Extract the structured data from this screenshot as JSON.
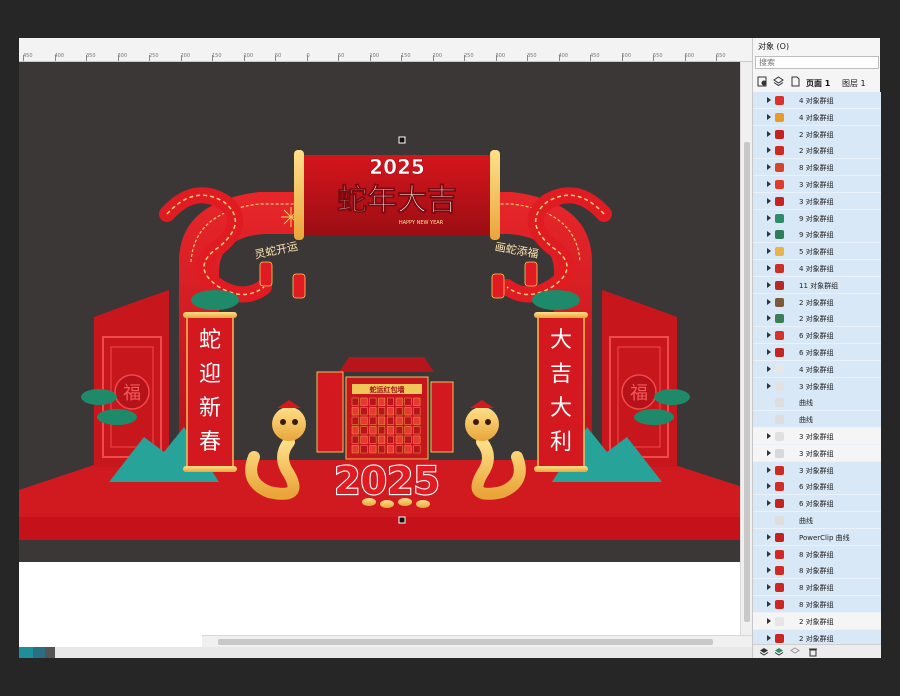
{
  "ruler": {
    "labels": [
      "450",
      "400",
      "350",
      "300",
      "250",
      "200",
      "150",
      "100",
      "50",
      "0",
      "50",
      "100",
      "150",
      "200",
      "250",
      "300",
      "350",
      "400",
      "450",
      "500",
      "550",
      "600",
      "650"
    ]
  },
  "design": {
    "banner_year": "2025",
    "banner_title": "蛇年大吉",
    "banner_subtitle": "HAPPY NEW YEAR",
    "left_slogan": "灵蛇开运",
    "right_slogan": "画蛇添福",
    "left_couplet": [
      "蛇",
      "迎",
      "新",
      "春"
    ],
    "right_couplet": [
      "大",
      "吉",
      "大",
      "利"
    ],
    "center_title": "蛇运红包墙",
    "big_year": "2025",
    "fu_char": "福"
  },
  "objects_panel": {
    "title": "对象 (O)",
    "search_placeholder": "搜索",
    "page_label": "页面 1",
    "layer_label": "图层 1",
    "items": [
      {
        "label": "4 对象群组",
        "color": "#d9322b",
        "expand": true,
        "plain": false
      },
      {
        "label": "4 对象群组",
        "color": "#e89a2b",
        "expand": true,
        "plain": false
      },
      {
        "label": "2 对象群组",
        "color": "#c62020",
        "expand": true,
        "plain": false
      },
      {
        "label": "2 对象群组",
        "color": "#cf2a22",
        "expand": true,
        "plain": false
      },
      {
        "label": "8 对象群组",
        "color": "#d7442c",
        "expand": true,
        "plain": false
      },
      {
        "label": "3 对象群组",
        "color": "#e03a2a",
        "expand": true,
        "plain": false
      },
      {
        "label": "3 对象群组",
        "color": "#c92222",
        "expand": true,
        "plain": false
      },
      {
        "label": "9 对象群组",
        "color": "#2d8c6a",
        "expand": true,
        "plain": false
      },
      {
        "label": "9 对象群组",
        "color": "#2e7c58",
        "expand": true,
        "plain": false
      },
      {
        "label": "5 对象群组",
        "color": "#e8b24c",
        "expand": true,
        "plain": false
      },
      {
        "label": "4 对象群组",
        "color": "#cc2f28",
        "expand": true,
        "plain": false
      },
      {
        "label": "11 对象群组",
        "color": "#b52b24",
        "expand": true,
        "plain": false
      },
      {
        "label": "2 对象群组",
        "color": "#7a5a3b",
        "expand": true,
        "plain": false
      },
      {
        "label": "2 对象群组",
        "color": "#3b7d57",
        "expand": true,
        "plain": false
      },
      {
        "label": "6 对象群组",
        "color": "#d5322a",
        "expand": true,
        "plain": false
      },
      {
        "label": "6 对象群组",
        "color": "#c32522",
        "expand": true,
        "plain": false
      },
      {
        "label": "4 对象群组",
        "color": "#e7e7e7",
        "expand": true,
        "plain": false
      },
      {
        "label": "3 对象群组",
        "color": "#e2e2e2",
        "expand": true,
        "plain": false
      },
      {
        "label": "曲线",
        "color": "#dddddd",
        "expand": false,
        "plain": false
      },
      {
        "label": "曲线",
        "color": "#dddddd",
        "expand": false,
        "plain": false
      },
      {
        "label": "3 对象群组",
        "color": "#e0e0e0",
        "expand": true,
        "plain": true
      },
      {
        "label": "3 对象群组",
        "color": "#d8d8d8",
        "expand": true,
        "plain": true
      },
      {
        "label": "3 对象群组",
        "color": "#cc2a22",
        "expand": true,
        "plain": false
      },
      {
        "label": "6 对象群组",
        "color": "#d32c24",
        "expand": true,
        "plain": false
      },
      {
        "label": "6 对象群组",
        "color": "#c62222",
        "expand": true,
        "plain": false
      },
      {
        "label": "曲线",
        "color": "#dddddd",
        "expand": false,
        "plain": false
      },
      {
        "label": "PowerClip 曲线",
        "color": "#c42020",
        "expand": true,
        "plain": false
      },
      {
        "label": "8 对象群组",
        "color": "#d02822",
        "expand": true,
        "plain": false
      },
      {
        "label": "8 对象群组",
        "color": "#cf2a24",
        "expand": true,
        "plain": false
      },
      {
        "label": "8 对象群组",
        "color": "#cc2620",
        "expand": true,
        "plain": false
      },
      {
        "label": "8 对象群组",
        "color": "#cb2621",
        "expand": true,
        "plain": false
      },
      {
        "label": "2 对象群组",
        "color": "#e5e5e5",
        "expand": true,
        "plain": true
      },
      {
        "label": "2 对象群组",
        "color": "#c92621",
        "expand": true,
        "plain": false
      }
    ]
  }
}
